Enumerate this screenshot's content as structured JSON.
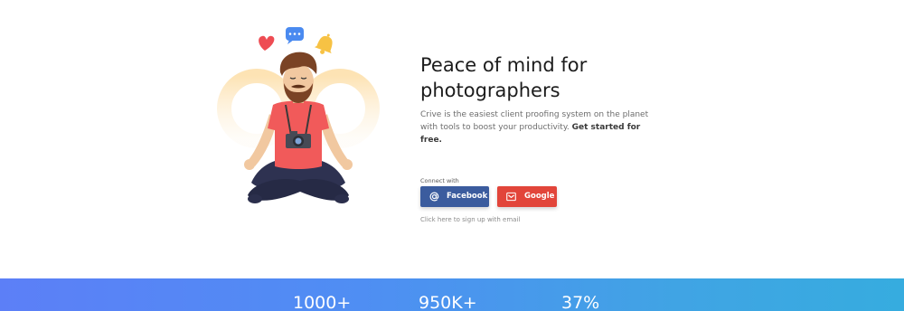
{
  "hero": {
    "headline_line1": "Peace of mind for",
    "headline_line2": "photographers",
    "description": "Crive is the easiest client proofing system on the planet with tools to boost your productivity.",
    "cta": "Get started for free."
  },
  "connect": {
    "label": "Connect with",
    "facebook_label": "Facebook",
    "google_label": "Google",
    "email_signup": "Click here to sign up with email"
  },
  "stats": {
    "items": [
      {
        "value": "1000+"
      },
      {
        "value": "950K+"
      },
      {
        "value": "37%"
      }
    ]
  },
  "colors": {
    "facebook": "#3b5c9e",
    "google": "#e2453a",
    "gradient_start": "#5c7ff7",
    "gradient_end": "#36acdf"
  },
  "icons": {
    "facebook": "at-sign-icon",
    "google": "mail-box-icon",
    "illustration": "meditating-photographer-illustration"
  }
}
